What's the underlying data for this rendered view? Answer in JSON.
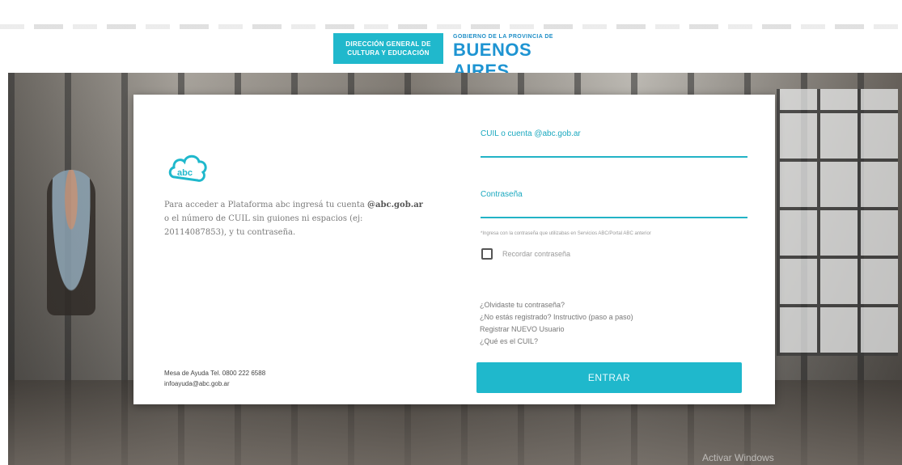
{
  "header": {
    "dgce_logo_text": "DIRECCIÓN GENERAL DE CULTURA Y EDUCACIÓN",
    "gba_logo_small": "GOBIERNO DE LA PROVINCIA DE",
    "gba_logo_big": "BUENOS AIRES"
  },
  "card": {
    "intro_prefix": "Para acceder a Plataforma abc ingresá tu cuenta",
    "intro_domain": "@abc.gob.ar",
    "intro_suffix": "o el número de CUIL sin guiones ni espacios (ej: 20114087853), y tu contraseña.",
    "help_line1": "Mesa de Ayuda Tel. 0800 222 6588",
    "help_line2": "infoayuda@abc.gob.ar",
    "user_label": "CUIL o cuenta @abc.gob.ar",
    "user_value": "",
    "password_label": "Contraseña",
    "password_value": "",
    "password_hint": "*Ingresa con la contraseña que utilizabas en Servicios ABC/Portal ABC anterior",
    "remember_label": "Recordar contraseña",
    "remember_checked": false,
    "links": [
      "¿Olvidaste tu contraseña?",
      "¿No estás registrado? Instructivo (paso a paso)",
      "Registrar NUEVO Usuario",
      "¿Qué es el CUIL?"
    ],
    "enter_button": "ENTRAR"
  },
  "watermark": "Activar Windows",
  "colors": {
    "accent": "#1fb8cc",
    "brand_blue": "#1e94d2"
  }
}
